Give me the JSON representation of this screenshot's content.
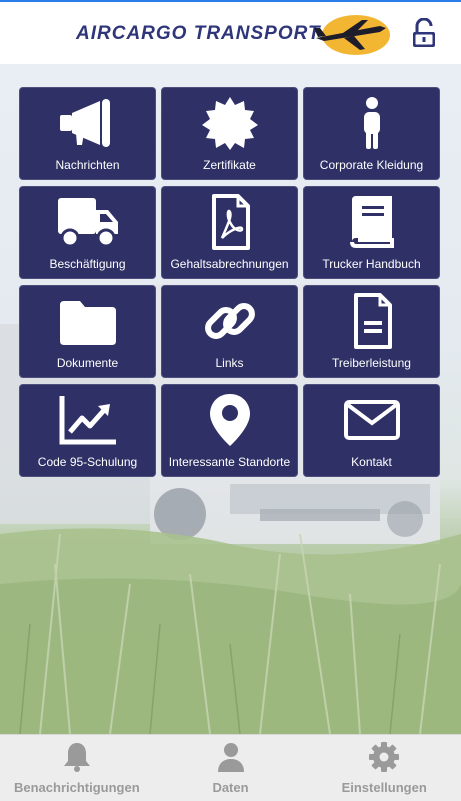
{
  "header": {
    "logo_text": "AIRCARGO TRANSPORT",
    "accent_color": "#f2b632",
    "brand_color": "#2e3679",
    "lock_icon": "unlock-icon"
  },
  "tiles": [
    {
      "label": "Nachrichten",
      "icon": "megaphone-icon"
    },
    {
      "label": "Zertifikate",
      "icon": "seal-icon"
    },
    {
      "label": "Corporate Kleidung",
      "icon": "person-icon"
    },
    {
      "label": "Beschäftigung",
      "icon": "truck-icon"
    },
    {
      "label": "Gehaltsabrechnungen",
      "icon": "pdf-file-icon"
    },
    {
      "label": "Trucker Handbuch",
      "icon": "book-icon"
    },
    {
      "label": "Dokumente",
      "icon": "folder-icon"
    },
    {
      "label": "Links",
      "icon": "link-icon"
    },
    {
      "label": "Treiberleistung",
      "icon": "document-icon"
    },
    {
      "label": "Code 95-Schulung",
      "icon": "chart-trend-icon"
    },
    {
      "label": "Interessante Standorte",
      "icon": "map-pin-icon"
    },
    {
      "label": "Kontakt",
      "icon": "envelope-icon"
    }
  ],
  "tabbar": [
    {
      "label": "Benachrichtigungen",
      "icon": "bell-icon"
    },
    {
      "label": "Daten",
      "icon": "user-icon"
    },
    {
      "label": "Einstellungen",
      "icon": "gear-icon"
    }
  ],
  "colors": {
    "tile_bg": "#2e3066",
    "tabbar_bg": "#ededed",
    "tab_label": "#9a9a9a"
  }
}
